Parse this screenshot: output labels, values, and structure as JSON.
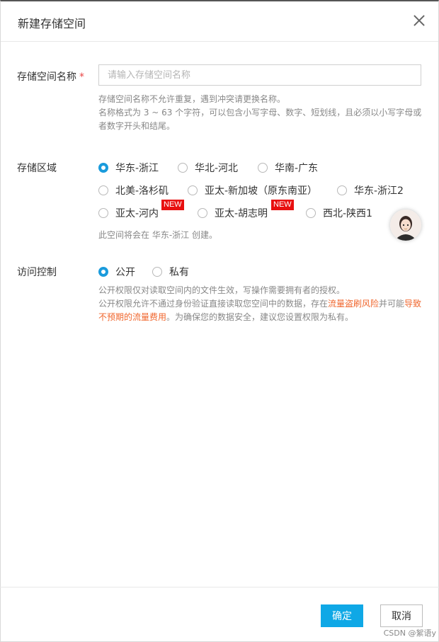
{
  "dialog": {
    "title": "新建存储空间"
  },
  "name_field": {
    "label": "存储空间名称",
    "required_mark": "*",
    "placeholder": "请输入存储空间名称",
    "hint_line1": "存储空间名称不允许重复，遇到冲突请更换名称。",
    "hint_line2": "名称格式为 3 ~ 63 个字符，可以包含小写字母、数字、短划线，且必须以小写字母或",
    "hint_line3": "者数字开头和结尾。"
  },
  "region": {
    "label": "存储区域",
    "options": [
      {
        "label": "华东-浙江",
        "selected": true
      },
      {
        "label": "华北-河北",
        "selected": false
      },
      {
        "label": "华南-广东",
        "selected": false
      },
      {
        "label": "北美-洛杉矶",
        "selected": false
      },
      {
        "label": "亚太-新加坡（原东南亚）",
        "selected": false
      },
      {
        "label": "华东-浙江2",
        "selected": false
      },
      {
        "label": "亚太-河内",
        "selected": false
      },
      {
        "label": "亚太-胡志明",
        "selected": false
      },
      {
        "label": "西北-陕西1",
        "selected": false
      }
    ],
    "new_badge": "NEW",
    "hint": "此空间将会在 华东-浙江 创建。"
  },
  "access": {
    "label": "访问控制",
    "options": [
      {
        "label": "公开",
        "selected": true
      },
      {
        "label": "私有",
        "selected": false
      }
    ],
    "hint_line1": "公开权限仅对读取空间内的文件生效，写操作需要拥有者的授权。",
    "hint_line2_a": "公开权限允许不通过身份验证直接读取您空间中的数据，存在",
    "hint_line2_link1": "流量盗刷风险",
    "hint_line2_b": "并可能",
    "hint_line2_link2a": "导致",
    "hint_line3_link2b": "不预期的流量费用",
    "hint_line3_c": "。为确保您的数据安全，建议您设置权限为私有。"
  },
  "footer": {
    "ok_label": "确定",
    "cancel_label": "取消"
  },
  "watermark": "CSDN @絮语y",
  "colors": {
    "accent": "#0fa8e6",
    "warning_link": "#f0662d",
    "badge": "#e81010"
  }
}
